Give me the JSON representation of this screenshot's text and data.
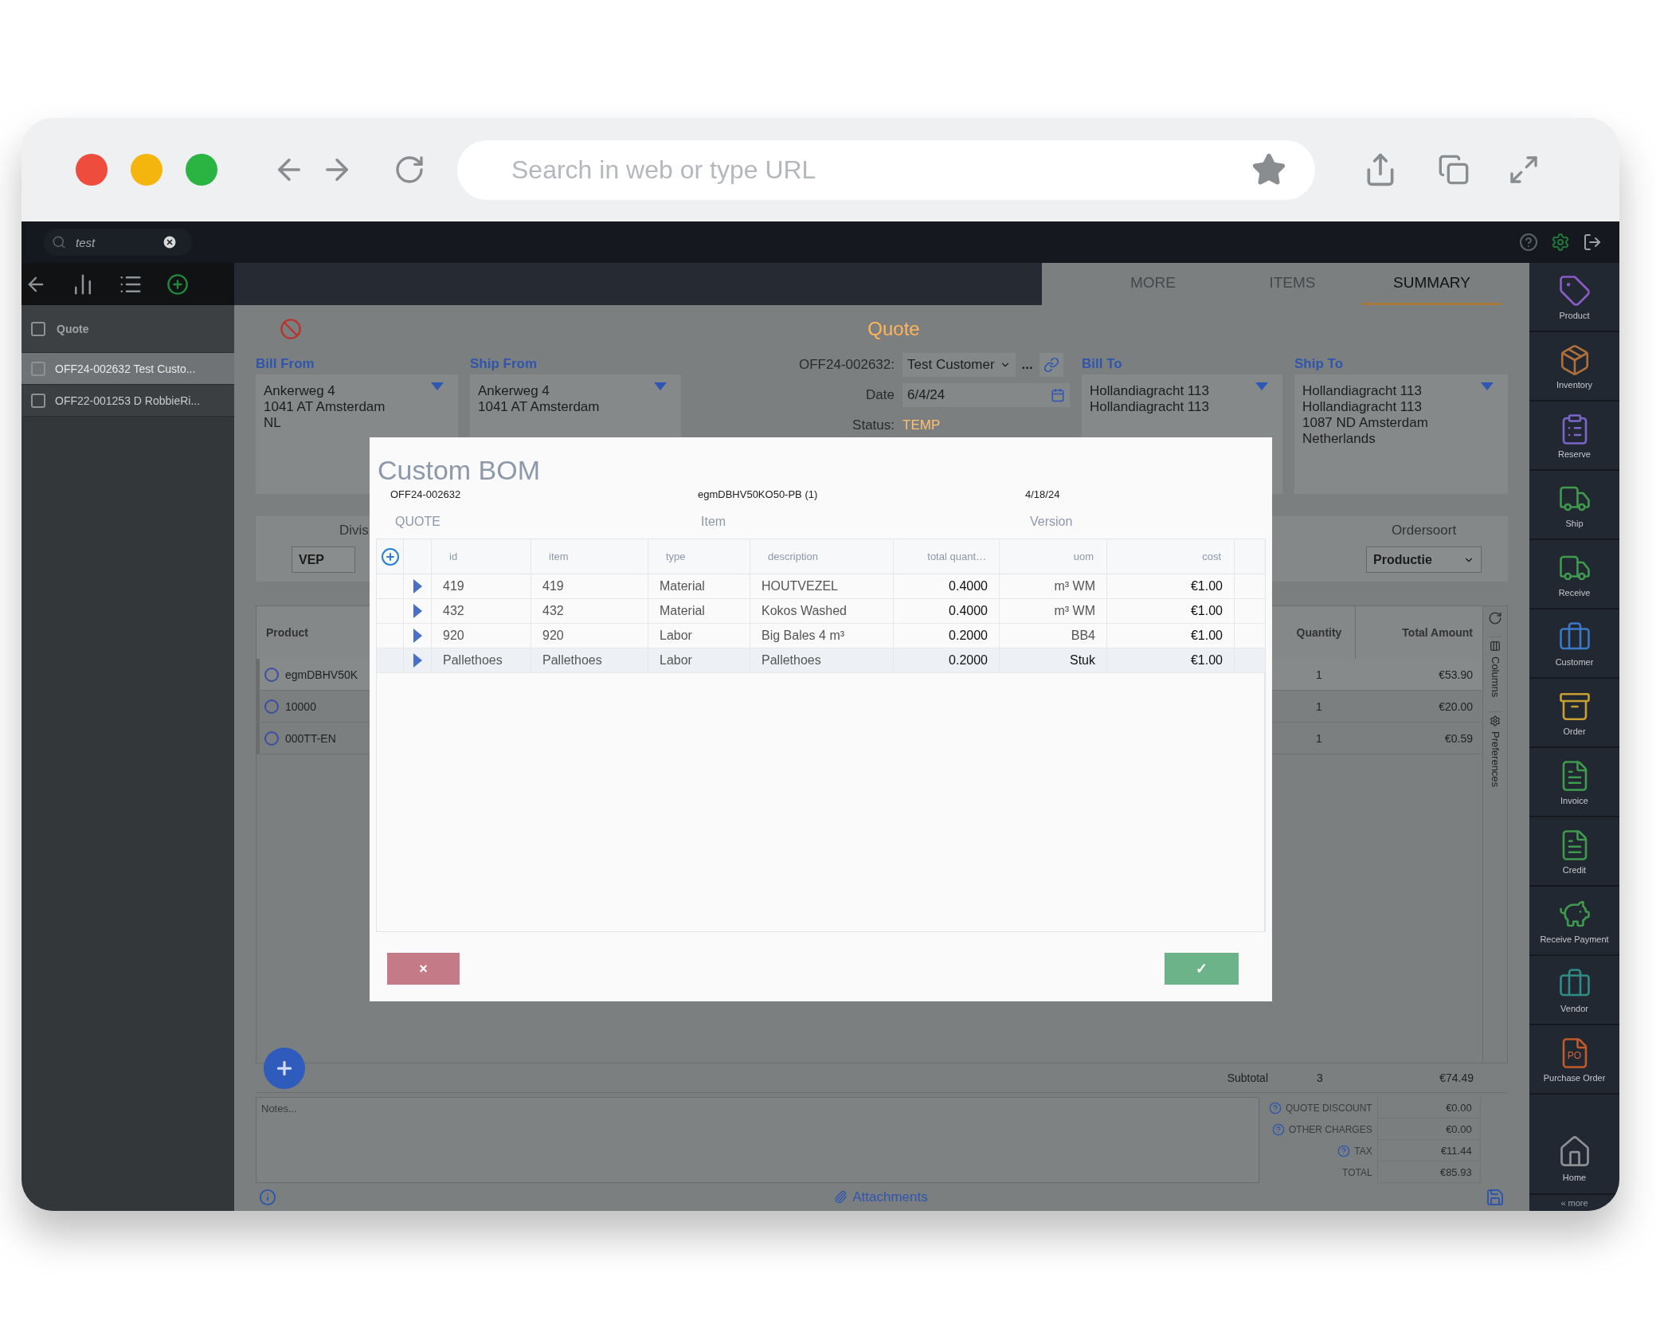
{
  "browser": {
    "url_placeholder": "Search in web or type URL"
  },
  "search": {
    "value": "test"
  },
  "sidebar": {
    "header": {
      "label": "Quote",
      "checked": false
    },
    "items": [
      {
        "label": "OFF24-002632 Test Custo...",
        "selected": true,
        "checked": false
      },
      {
        "label": "OFF22-001253 D RobbieRi...",
        "selected": false,
        "checked": false
      }
    ]
  },
  "tabs": [
    {
      "label": "MORE",
      "selected": false
    },
    {
      "label": "ITEMS",
      "selected": false
    },
    {
      "label": "SUMMARY",
      "selected": true
    }
  ],
  "quote": {
    "title": "Quote",
    "number_label": "OFF24-002632:",
    "customer": "Test Customer",
    "more": "...",
    "date_label": "Date",
    "date": "6/4/24",
    "status_label": "Status:",
    "status": "TEMP"
  },
  "from_addresses": [
    {
      "label": "Bill From",
      "lines": [
        "Ankerweg 4",
        "1041 AT Amsterdam",
        "NL"
      ]
    },
    {
      "label": "Ship From",
      "lines": [
        "Ankerweg 4",
        "1041 AT Amsterdam"
      ]
    }
  ],
  "to_addresses": [
    {
      "label": "Bill To",
      "lines": [
        "Hollandiagracht 113",
        "Hollandiagracht 113"
      ]
    },
    {
      "label": "Ship To",
      "lines": [
        "Hollandiagracht 113",
        "Hollandiagracht 113",
        "1087 ND Amsterdam",
        "Netherlands"
      ]
    }
  ],
  "division": {
    "label": "Divis",
    "value": "VEP"
  },
  "ordersoort": {
    "label": "Ordersoort",
    "value": "Productie"
  },
  "products": {
    "columns": [
      "Product",
      "Quantity",
      "Total Amount"
    ],
    "rows": [
      {
        "product": "egmDBHV50K",
        "quantity": "1",
        "total": "€53.90",
        "selected": false
      },
      {
        "product": "10000",
        "quantity": "1",
        "total": "€20.00",
        "selected": false
      },
      {
        "product": "000TT-EN",
        "quantity": "1",
        "total": "€0.59",
        "selected": false
      }
    ],
    "side_tabs": [
      "Columns",
      "Preferences"
    ]
  },
  "summary": {
    "subtotal_label": "Subtotal",
    "subtotal_quantity": "3",
    "subtotal": "€74.49",
    "notes_placeholder": "Notes...",
    "totals": [
      {
        "label": "QUOTE DISCOUNT",
        "value": "€0.00",
        "help": true
      },
      {
        "label": "OTHER CHARGES",
        "value": "€0.00",
        "help": true
      },
      {
        "label": "TAX",
        "value": "€11.44",
        "help": true
      },
      {
        "label": "TOTAL",
        "value": "€85.93",
        "help": false
      }
    ]
  },
  "attachments": "Attachments",
  "right_nav": [
    {
      "label": "Product"
    },
    {
      "label": "Inventory"
    },
    {
      "label": "Reserve"
    },
    {
      "label": "Ship"
    },
    {
      "label": "Receive"
    },
    {
      "label": "Customer"
    },
    {
      "label": "Order"
    },
    {
      "label": "Invoice"
    },
    {
      "label": "Credit"
    },
    {
      "label": "Receive Payment"
    },
    {
      "label": "Vendor"
    },
    {
      "label": "Purchase Order",
      "badge": "PO"
    }
  ],
  "home": {
    "label": "Home"
  },
  "more": "« more",
  "modal": {
    "title": "Custom BOM",
    "fields": [
      {
        "value": "OFF24-002632",
        "label": "QUOTE"
      },
      {
        "value": "egmDBHV50KO50-PB (1)",
        "label": "Item"
      },
      {
        "value": "4/18/24",
        "label": "Version"
      }
    ],
    "columns": [
      "id",
      "item",
      "type",
      "description",
      "total quant…",
      "uom",
      "cost"
    ],
    "rows": [
      {
        "id": "419",
        "item": "419",
        "type": "Material",
        "description": "HOUTVEZEL",
        "total_quantity": "0.4000",
        "uom": "m³ WM",
        "cost": "€1.00",
        "selected": false
      },
      {
        "id": "432",
        "item": "432",
        "type": "Material",
        "description": "Kokos Washed",
        "total_quantity": "0.4000",
        "uom": "m³ WM",
        "cost": "€1.00",
        "selected": false
      },
      {
        "id": "920",
        "item": "920",
        "type": "Labor",
        "description": "Big Bales 4 m³",
        "total_quantity": "0.2000",
        "uom": "BB4",
        "cost": "€1.00",
        "selected": false
      },
      {
        "id": "Pallethoes",
        "item": "Pallethoes",
        "type": "Labor",
        "description": "Pallethoes",
        "total_quantity": "0.2000",
        "uom": "Stuk",
        "cost": "€1.00",
        "selected": true
      }
    ],
    "buttons": [
      {
        "kind": "cancel",
        "label": "×"
      },
      {
        "kind": "confirm",
        "label": "✓"
      }
    ]
  }
}
